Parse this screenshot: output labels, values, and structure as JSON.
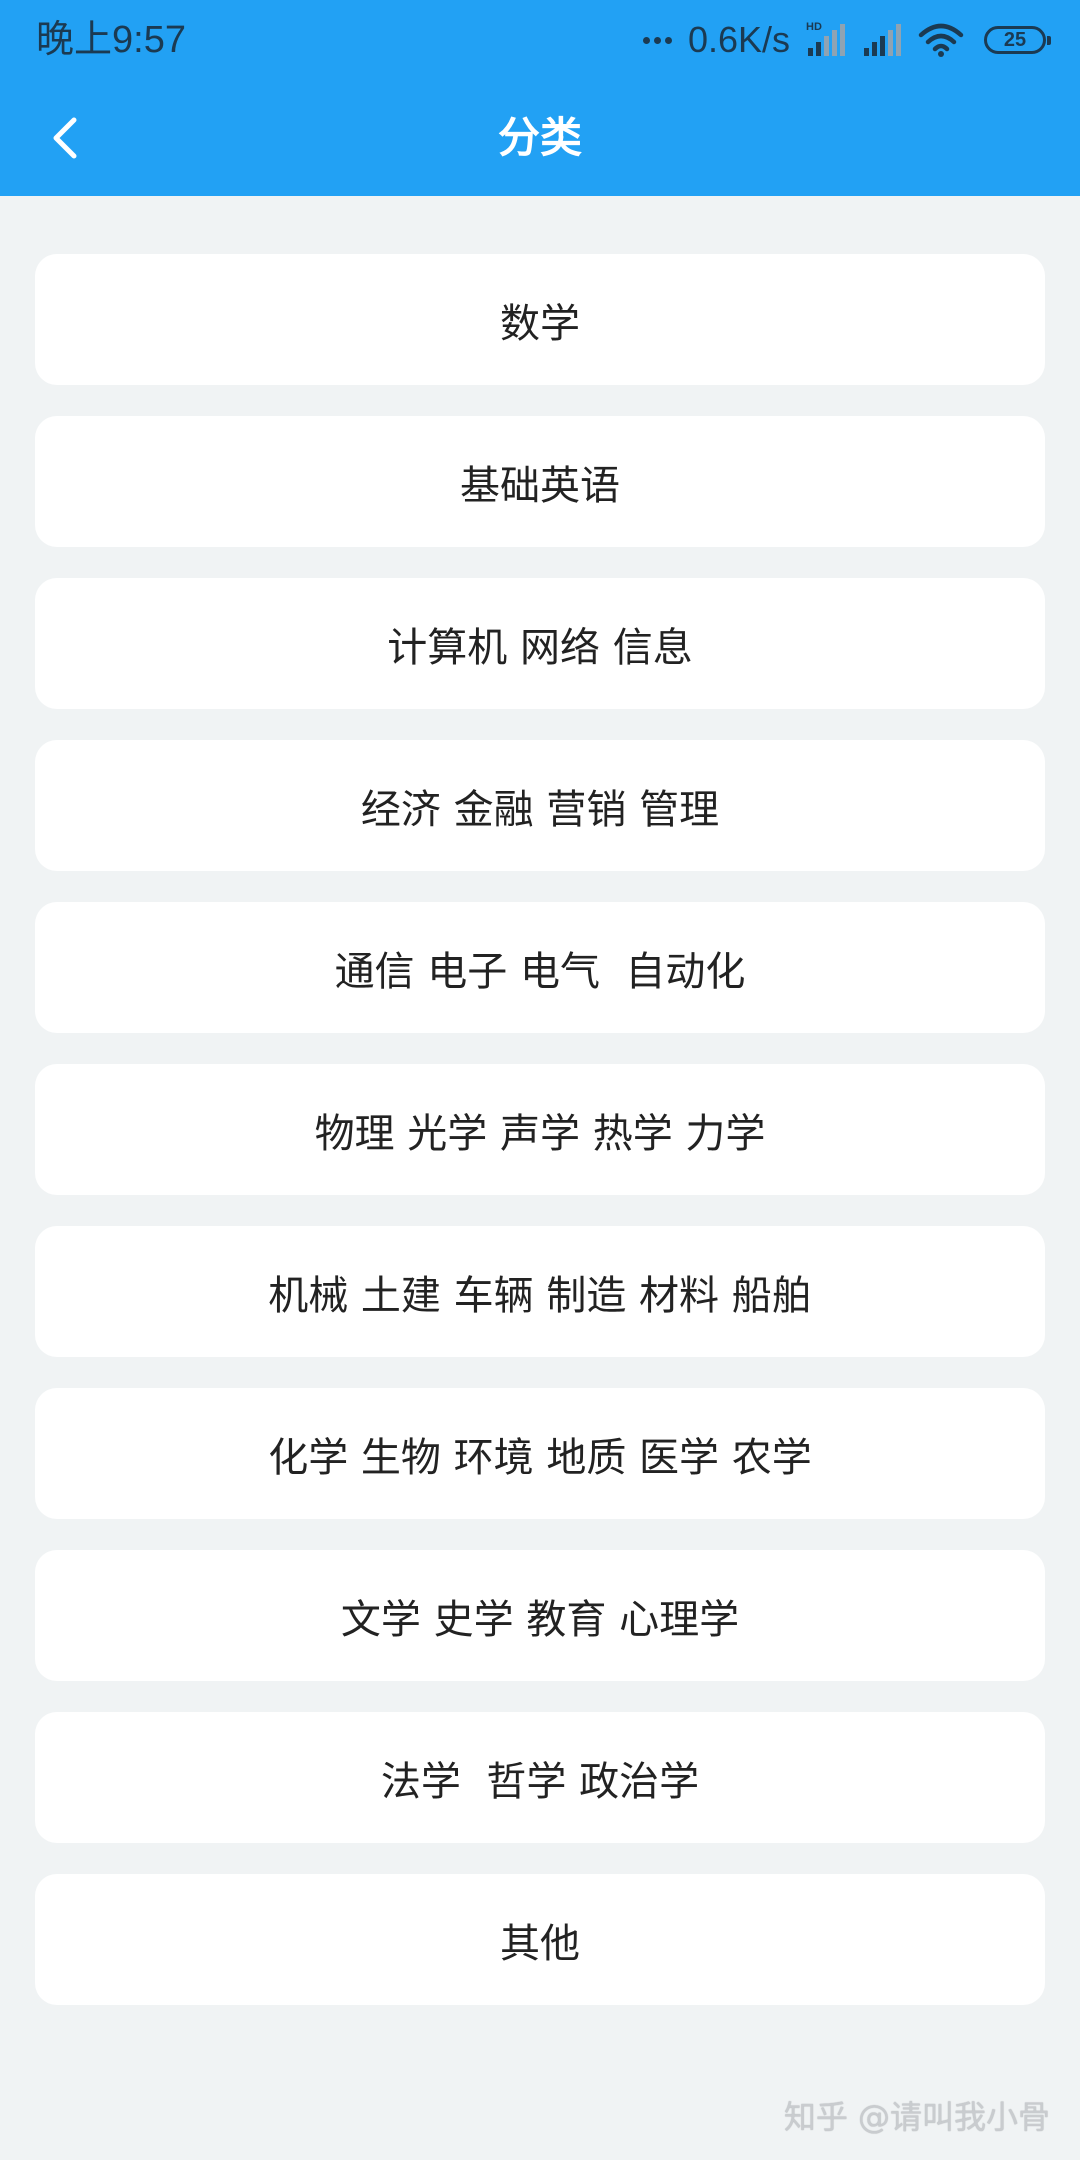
{
  "status_bar": {
    "time": "晚上9:57",
    "net_speed": "0.6K/s",
    "battery": "25",
    "signal_label": "HD"
  },
  "header": {
    "title": "分类"
  },
  "categories": [
    {
      "label": "数学"
    },
    {
      "label": "基础英语"
    },
    {
      "label": "计算机 网络 信息"
    },
    {
      "label": "经济 金融 营销 管理"
    },
    {
      "label": "通信 电子 电气  自动化"
    },
    {
      "label": "物理 光学 声学 热学 力学"
    },
    {
      "label": "机械 土建 车辆 制造 材料 船舶"
    },
    {
      "label": "化学 生物 环境 地质 医学 农学"
    },
    {
      "label": "文学 史学 教育 心理学"
    },
    {
      "label": "法学  哲学 政治学"
    },
    {
      "label": "其他"
    }
  ],
  "watermark": "知乎 @请叫我小骨",
  "colors": {
    "header_bg": "#22a1f4",
    "page_bg": "#f0f3f4",
    "card_bg": "#ffffff",
    "text": "#222222"
  },
  "icons": {
    "back": "chevron-left-icon",
    "signal": "cell-signal-icon",
    "wifi": "wifi-icon",
    "battery": "battery-icon"
  }
}
